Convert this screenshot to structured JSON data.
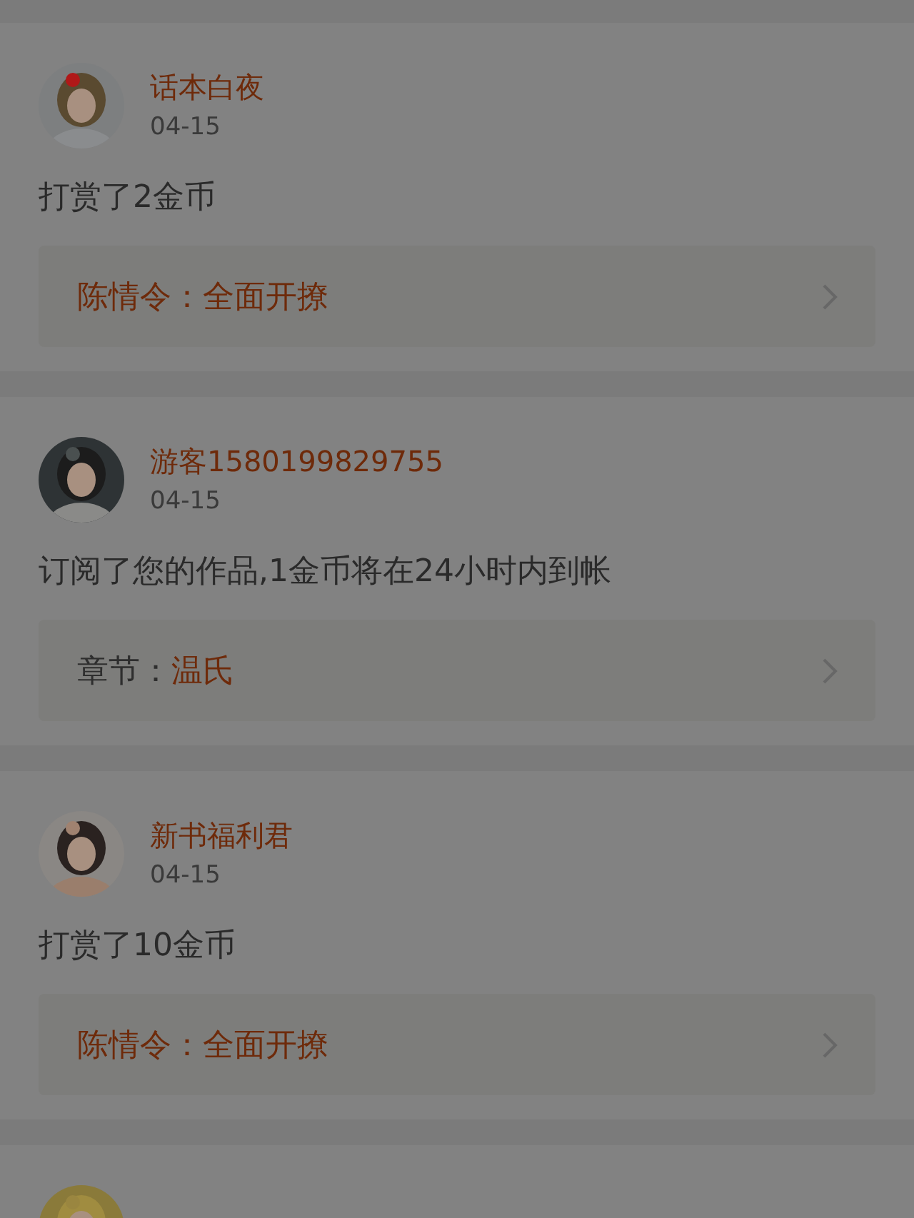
{
  "items": [
    {
      "avatar": {
        "kind": "picture"
      },
      "name": "话本白夜",
      "date": "04-15",
      "message": "打赏了2金币",
      "link": {
        "title": "陈情令：全面开撩"
      }
    },
    {
      "avatar": {
        "kind": "picture"
      },
      "name": "游客1580199829755",
      "date": "04-15",
      "message": "订阅了您的作品,1金币将在24小时内到帐",
      "link": {
        "label": "章节：",
        "title": "温氏"
      }
    },
    {
      "avatar": {
        "kind": "picture"
      },
      "name": "新书福利君",
      "date": "04-15",
      "message": "打赏了10金币",
      "link": {
        "title": "陈情令：全面开撩"
      }
    },
    {
      "avatar": {
        "kind": "picture"
      }
    }
  ]
}
